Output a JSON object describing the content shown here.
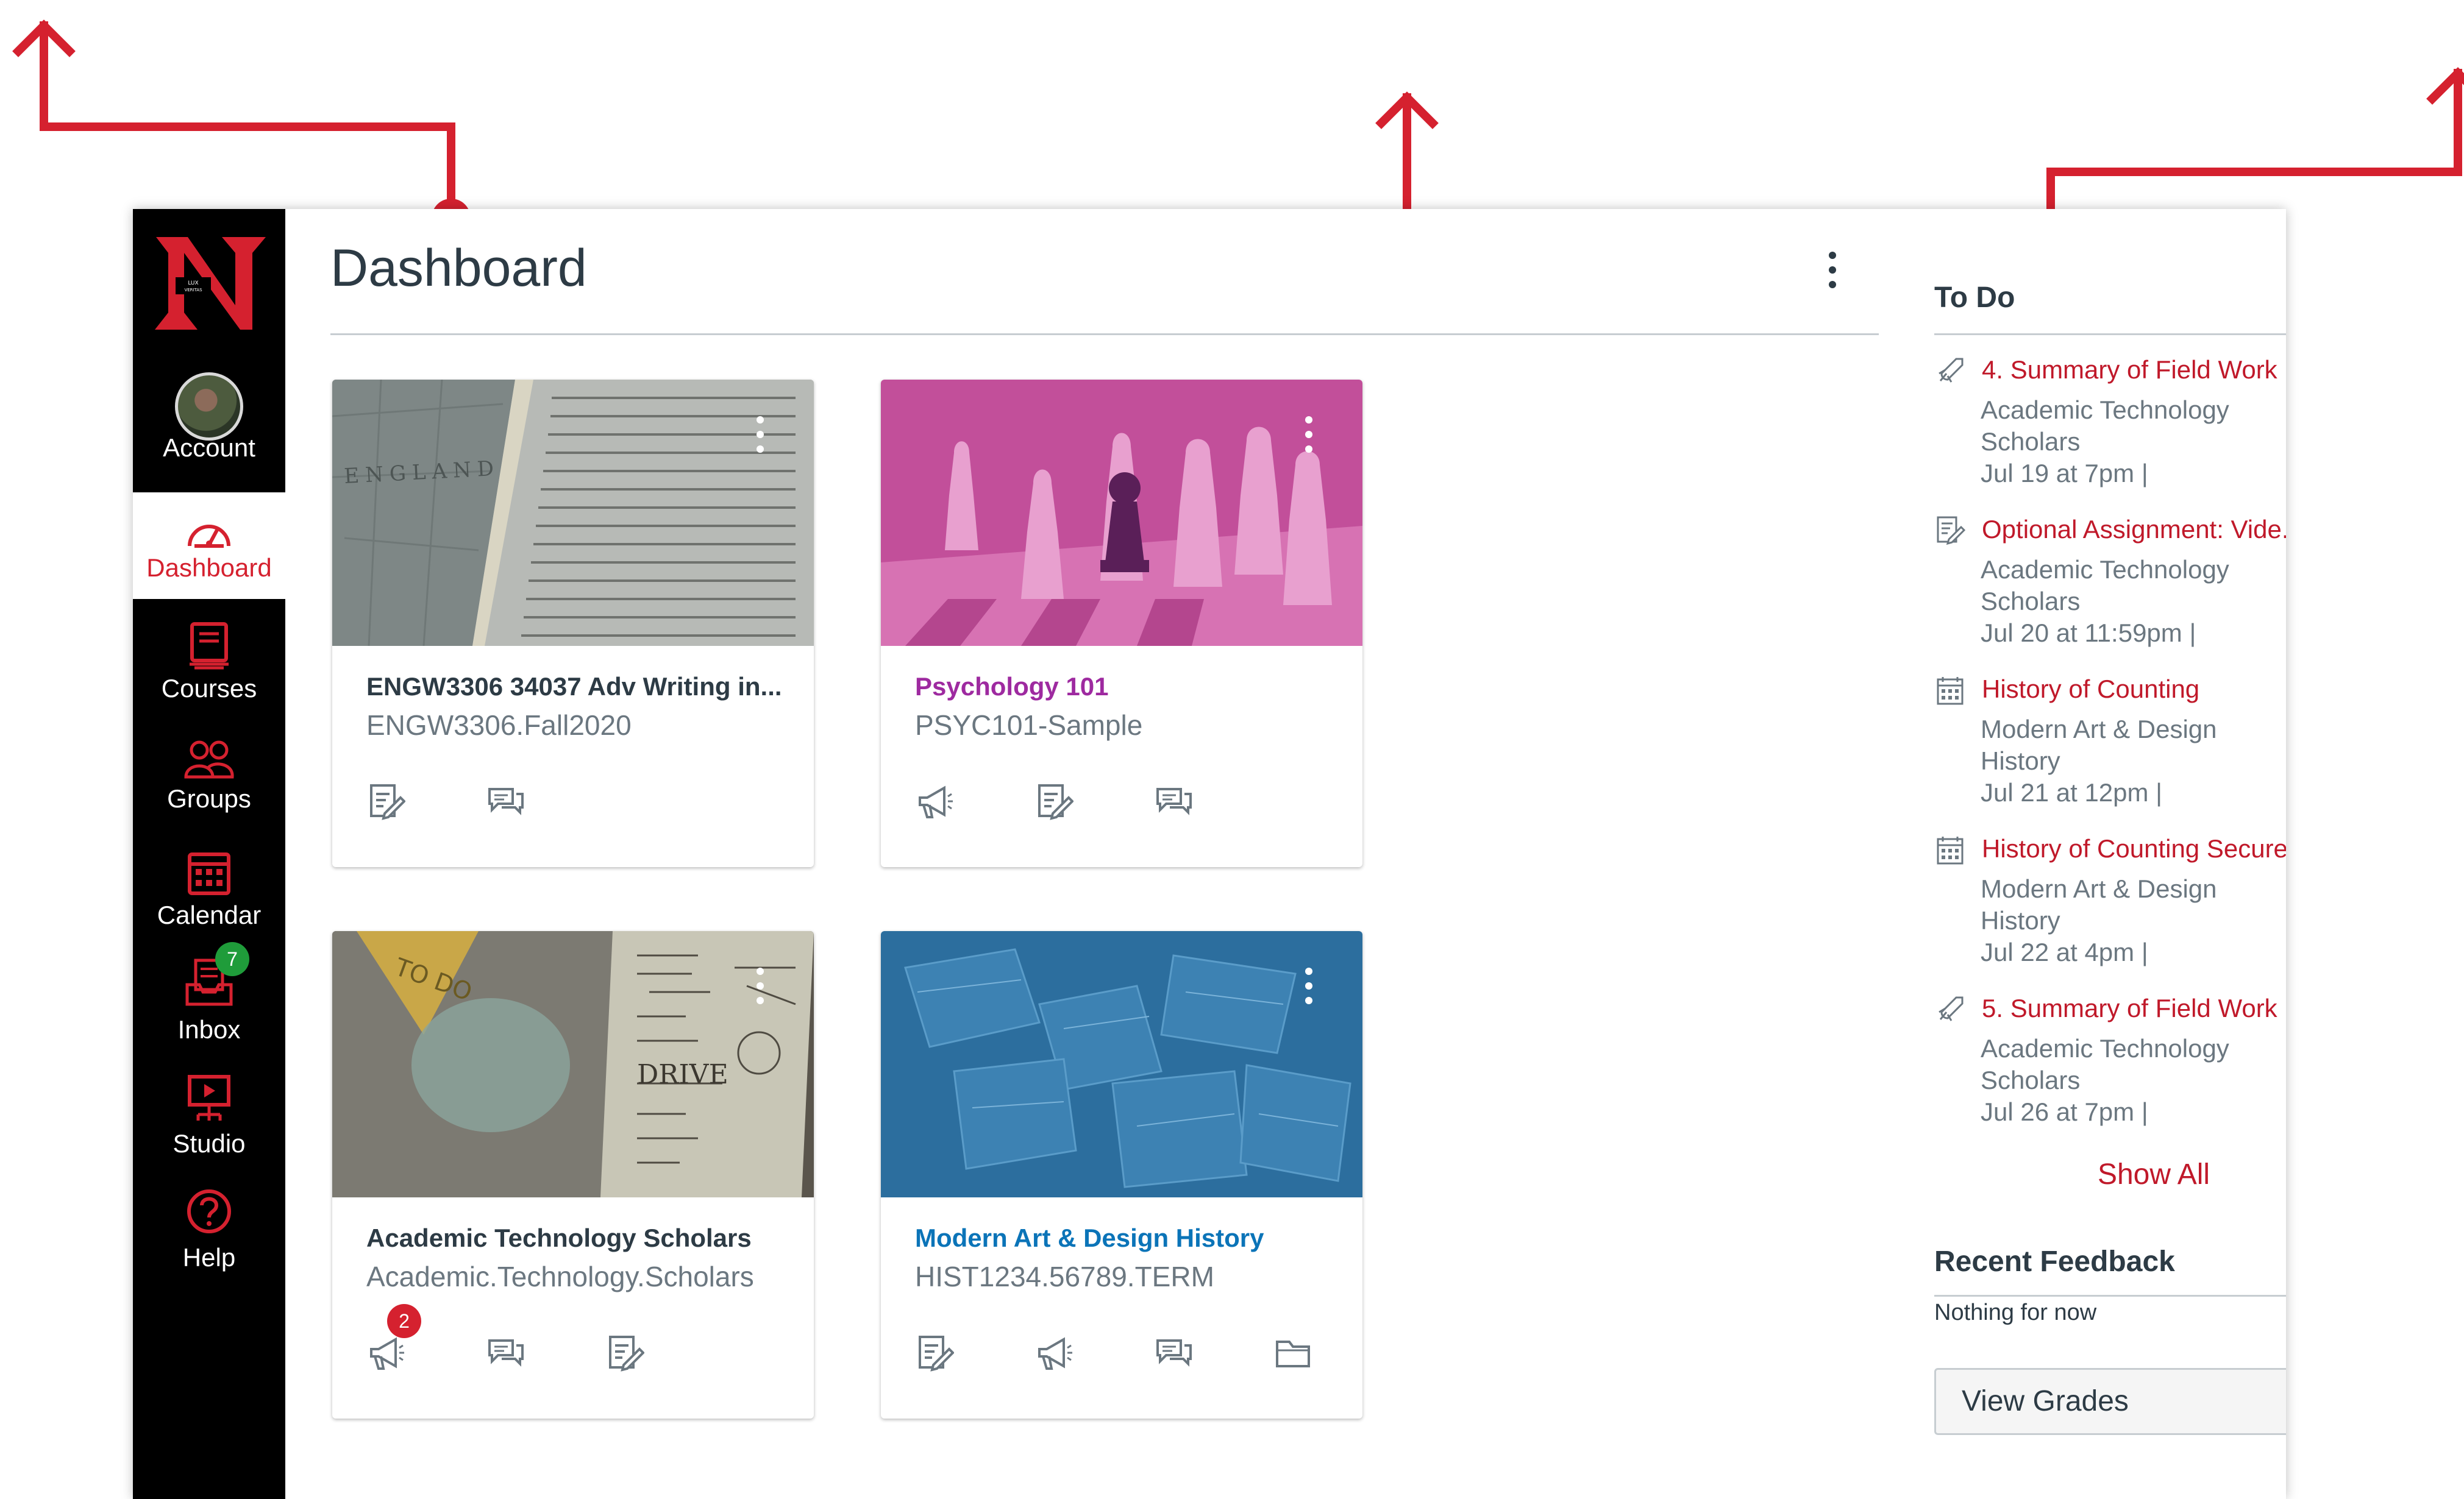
{
  "colors": {
    "accent_red": "#d5212f",
    "nav_bg": "#000000",
    "psychology_text": "#9e2aa0",
    "modern_art_text": "#0b74b8",
    "default_course_text": "#2d3b45",
    "inbox_badge": "#1f9c3a"
  },
  "global_nav": {
    "logo_icon": "university-n-logo",
    "items": [
      {
        "label": "Account",
        "icon": "avatar"
      },
      {
        "label": "Dashboard",
        "icon": "dashboard-gauge-icon",
        "active": true
      },
      {
        "label": "Courses",
        "icon": "courses-book-icon"
      },
      {
        "label": "Groups",
        "icon": "groups-people-icon"
      },
      {
        "label": "Calendar",
        "icon": "calendar-icon"
      },
      {
        "label": "Inbox",
        "icon": "inbox-icon",
        "badge": "7"
      },
      {
        "label": "Studio",
        "icon": "studio-icon"
      },
      {
        "label": "Help",
        "icon": "help-question-icon"
      }
    ]
  },
  "main": {
    "title": "Dashboard",
    "cards": [
      {
        "name": "ENGW3306 34037 Adv Writing in...",
        "code": "ENGW3306.Fall2020",
        "hero": "book-and-map-photo",
        "icons": [
          "assignments-icon",
          "discussions-icon"
        ]
      },
      {
        "name": "Psychology 101",
        "code": "PSYC101-Sample",
        "hero": "chess-pieces-photo",
        "icons": [
          "announcements-icon",
          "assignments-icon",
          "discussions-icon"
        ]
      },
      {
        "name": "Academic Technology Scholars",
        "code": "Academic.Technology.Scholars",
        "hero": "laptop-and-notes-photo",
        "icons": [
          "announcements-icon",
          "discussions-icon",
          "assignments-icon"
        ],
        "badge": "2"
      },
      {
        "name": "Modern Art & Design History",
        "code": "HIST1234.56789.TERM",
        "hero": "scattered-maps-photo",
        "icons": [
          "assignments-icon",
          "announcements-icon",
          "discussions-icon",
          "files-folder-icon"
        ]
      }
    ]
  },
  "sidebar": {
    "todo_heading": "To Do",
    "todo_items": [
      {
        "icon": "quiz-rocket-icon",
        "title": "4. Summary of Field Work ...",
        "course": "Academic Technology Scholars",
        "date": "Jul 19 at 7pm  |"
      },
      {
        "icon": "assignment-icon",
        "title": "Optional Assignment: Vide...",
        "course": "Academic Technology Scholars",
        "date": "Jul 20 at 11:59pm  |"
      },
      {
        "icon": "calendar-event-icon",
        "title": "History of Counting",
        "course": "Modern Art & Design History",
        "date": "Jul 21 at 12pm  |"
      },
      {
        "icon": "calendar-event-icon",
        "title": "History of Counting Secure",
        "course": "Modern Art & Design History",
        "date": "Jul 22 at 4pm  |"
      },
      {
        "icon": "quiz-rocket-icon",
        "title": "5. Summary of Field Work ...",
        "course": "Academic Technology Scholars",
        "date": "Jul 26 at 7pm  |"
      }
    ],
    "close_glyph": "✕",
    "show_all": "Show All",
    "feedback_heading": "Recent Feedback",
    "feedback_empty": "Nothing for now",
    "view_grades": "View Grades"
  }
}
